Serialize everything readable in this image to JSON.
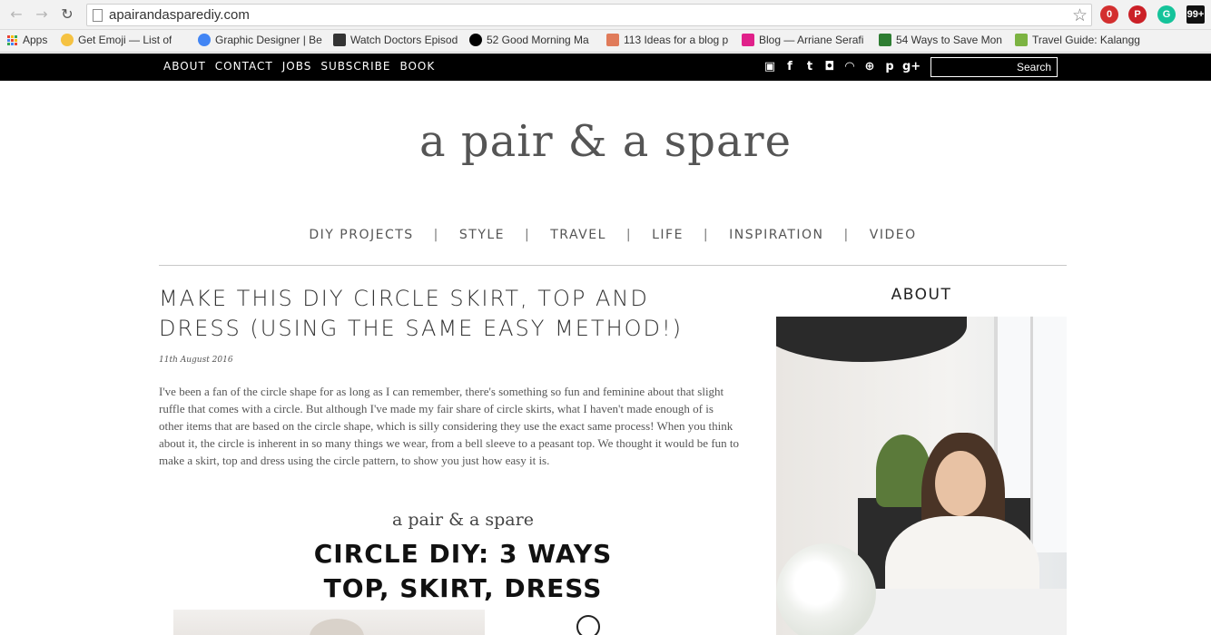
{
  "browser": {
    "url": "apairandasparediy.com",
    "extensions": [
      {
        "name": "adblock-icon",
        "label": "0",
        "color": "#d32f2f"
      },
      {
        "name": "pinterest-icon",
        "label": "P",
        "color": "#cb2027"
      },
      {
        "name": "grammarly-icon",
        "label": "G",
        "color": "#15c39a"
      },
      {
        "name": "bloglovin-icon",
        "label": "99+",
        "color": "#111111"
      }
    ],
    "bookmarks": [
      {
        "label": "Apps",
        "icon": "apps-grid-icon"
      },
      {
        "label": "Get Emoji — List of",
        "icon": "emoji-icon",
        "color": "#f5c242"
      },
      {
        "label": "Graphic Designer | Be",
        "icon": "chrome-icon",
        "color": "#4285f4"
      },
      {
        "label": "Watch Doctors Episod",
        "icon": "tv-icon",
        "color": "#333333"
      },
      {
        "label": "52 Good Morning Ma",
        "icon": "circle-e-icon",
        "color": "#000000"
      },
      {
        "label": "113 Ideas for a blog p",
        "icon": "bars-icon",
        "color": "#e07b5a"
      },
      {
        "label": "Blog — Arriane Serafi",
        "icon": "stripes-icon",
        "color": "#e0218a"
      },
      {
        "label": "54 Ways to Save Mon",
        "icon": "dollar-icon",
        "color": "#2e7d32"
      },
      {
        "label": "Travel Guide: Kalangg",
        "icon": "globe-icon",
        "color": "#7cb342"
      }
    ]
  },
  "topbar": {
    "nav": [
      "ABOUT",
      "CONTACT",
      "JOBS",
      "SUBSCRIBE",
      "BOOK"
    ],
    "social": [
      {
        "name": "youtube-icon",
        "glyph": "▣"
      },
      {
        "name": "facebook-icon",
        "glyph": "f"
      },
      {
        "name": "twitter-icon",
        "glyph": "t"
      },
      {
        "name": "instagram-icon",
        "glyph": "◘"
      },
      {
        "name": "rss-icon",
        "glyph": "◠"
      },
      {
        "name": "bloglovin-plus-icon",
        "glyph": "⊕"
      },
      {
        "name": "pinterest-icon",
        "glyph": "p"
      },
      {
        "name": "google-plus-icon",
        "glyph": "g+"
      }
    ],
    "search_label": "Search"
  },
  "site": {
    "title": "a pair & a spare",
    "nav": [
      "DIY PROJECTS",
      "STYLE",
      "TRAVEL",
      "LIFE",
      "INSPIRATION",
      "VIDEO"
    ],
    "nav_separator": "|"
  },
  "post": {
    "title": "MAKE THIS DIY CIRCLE SKIRT, TOP AND DRESS (USING THE SAME EASY METHOD!)",
    "date": "11th August 2016",
    "body": "I've been a fan of the circle shape for as long as I can remember, there's something so fun and feminine about that slight ruffle that comes with a circle. But although I've made my fair share of circle skirts, what I haven't made enough of is other items that are based on the circle shape, which is silly considering they use the exact same process! When you think about it, the circle is inherent in so many things we wear, from a bell sleeve to a peasant top. We thought it would be fun to make a skirt, top and dress using the circle pattern, to show you just how easy it is.",
    "image_brand": "a pair & a spare",
    "image_headline_1": "CIRCLE DIY: 3 WAYS",
    "image_headline_2": "TOP, SKIRT, DRESS"
  },
  "sidebar": {
    "title": "ABOUT"
  }
}
